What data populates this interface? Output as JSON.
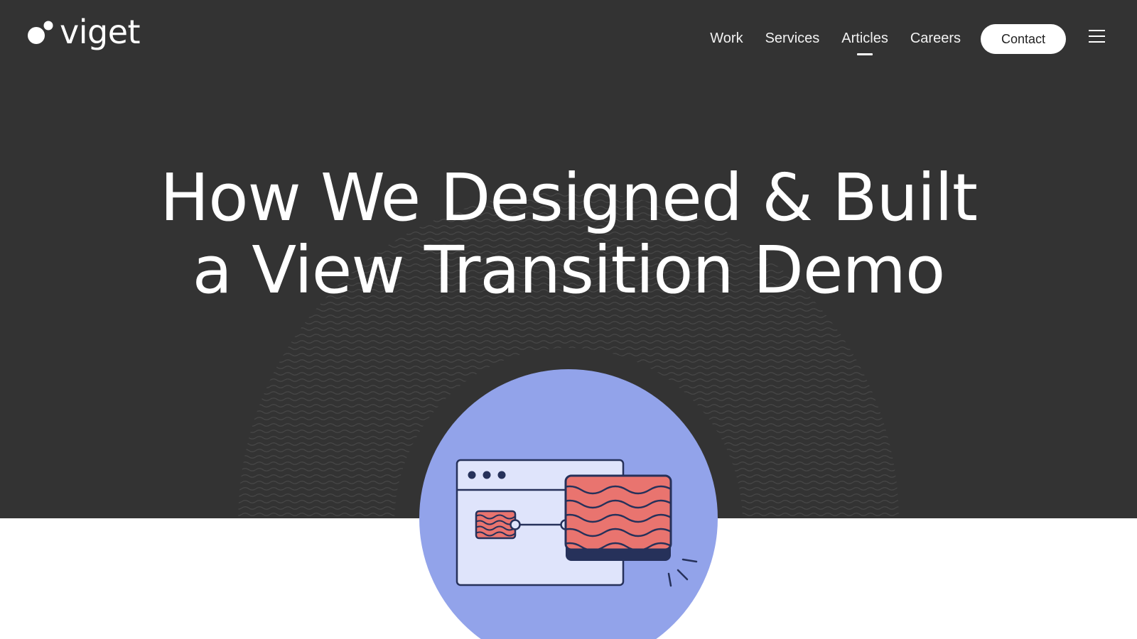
{
  "brand": {
    "name": "viget",
    "logo_icon": "two-dots-logo-icon"
  },
  "nav": {
    "links": [
      {
        "label": "Work",
        "active": false
      },
      {
        "label": "Services",
        "active": false
      },
      {
        "label": "Articles",
        "active": true
      },
      {
        "label": "Careers",
        "active": false
      }
    ],
    "contact_label": "Contact",
    "menu_icon": "hamburger-menu-icon"
  },
  "hero": {
    "title_line1": "How We Designed & Built",
    "title_line2": "a View Transition Demo"
  },
  "illustration": {
    "icon": "view-transition-illustration",
    "colors": {
      "circle": "#92a3ea",
      "window": "#dfe4fb",
      "outline": "#26315a",
      "card": "#e9746f"
    }
  },
  "colors": {
    "hero_bg": "#333333",
    "page_bg": "#ffffff",
    "text": "#ffffff"
  }
}
